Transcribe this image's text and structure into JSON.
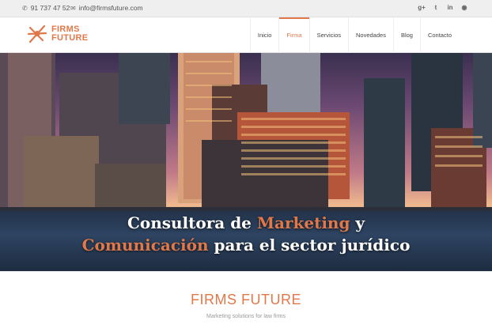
{
  "topbar": {
    "phone": "91 737 47 52",
    "email": "info@firmsfuture.com",
    "social": [
      "g+",
      "twitter",
      "linkedin",
      "rss"
    ]
  },
  "logo": {
    "line1": "FIRMS",
    "line2": "FUTURE"
  },
  "nav": {
    "items": [
      {
        "label": "Inicio"
      },
      {
        "label": "Firma"
      },
      {
        "label": "Servicios"
      },
      {
        "label": "Novedades"
      },
      {
        "label": "Blog"
      },
      {
        "label": "Contacto"
      }
    ],
    "active": "Firma"
  },
  "hero": {
    "title_l1_a": "Consultora de ",
    "title_l1_accent": "Marketing",
    "title_l1_b": " y",
    "title_l2_accent": "Comunicación",
    "title_l2_b": " para el sector jurídico"
  },
  "intro": {
    "title": "FIRMS FUTURE",
    "subtitle": "Marketing solutions for law firms"
  },
  "colors": {
    "accent": "#e0784a"
  }
}
